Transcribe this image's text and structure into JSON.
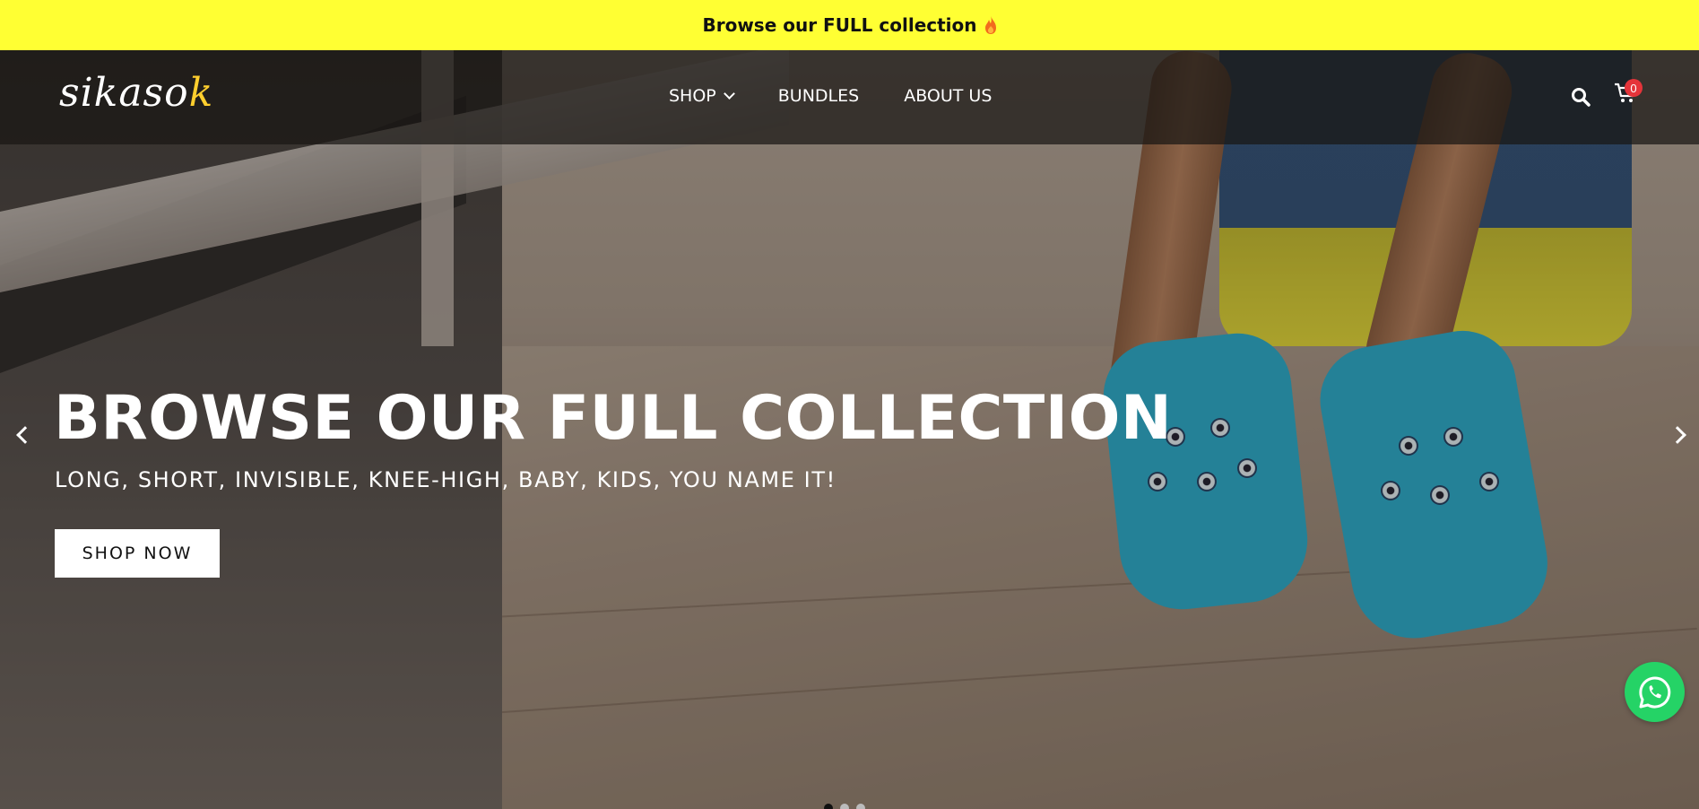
{
  "announcement": {
    "text": "Browse our FULL collection",
    "icon": "flame-icon"
  },
  "header": {
    "logo_text": "sikasok",
    "nav": [
      {
        "label": "SHOP",
        "has_dropdown": true
      },
      {
        "label": "BUNDLES"
      },
      {
        "label": "ABOUT US"
      }
    ],
    "search_icon": "search-icon",
    "cart_icon": "cart-icon",
    "cart_count": "0"
  },
  "hero": {
    "title": "BROWSE OUR FULL COLLECTION",
    "subtitle": "LONG, SHORT, INVISIBLE, KNEE-HIGH, BABY, KIDS, YOU NAME IT!",
    "cta_label": "SHOP NOW",
    "slides_total": 3,
    "active_slide": 1
  },
  "floating": {
    "whatsapp_icon": "whatsapp-icon"
  },
  "colors": {
    "announcement_bg": "#ffff33",
    "whatsapp": "#25d366",
    "badge": "#e5343a"
  }
}
